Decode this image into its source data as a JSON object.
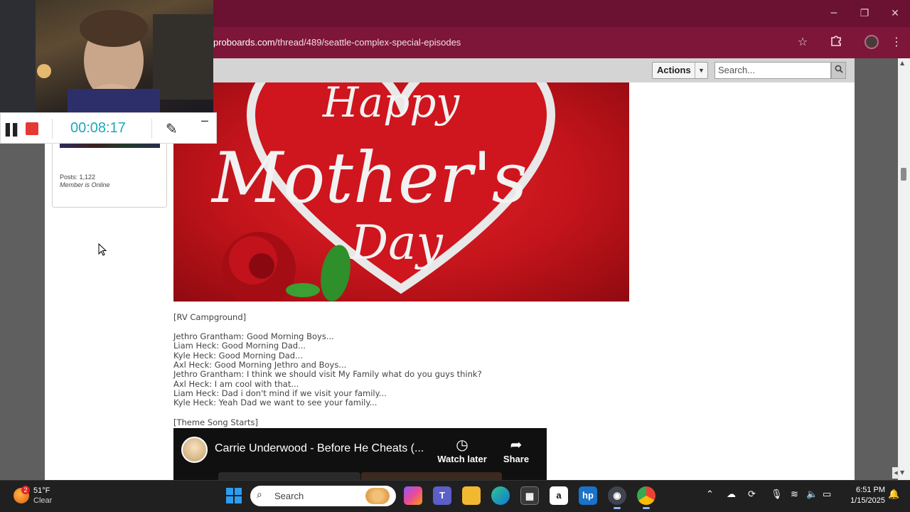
{
  "browser": {
    "url_host": "proboards.com",
    "url_path": "/thread/489/seattle-complex-special-episodes",
    "bookmark_icon": "star-icon",
    "extensions_icon": "puzzle-icon",
    "menu_icon": "kebab-icon",
    "minimize_glyph": "─",
    "maximize_glyph": "❐",
    "close_glyph": "✕"
  },
  "forum": {
    "actions_label": "Actions",
    "search_placeholder": "Search..."
  },
  "user_card": {
    "posts": "Posts: 1,122",
    "status": "Member is Online"
  },
  "hero": {
    "line1": "Happy",
    "line2": "Mother's",
    "line3": "Day"
  },
  "post": {
    "scene1": "[RV Campground]",
    "dialogue": [
      "Jethro Grantham: Good Morning Boys...",
      "Liam Heck: Good Morning Dad...",
      "Kyle Heck: Good Morning Dad...",
      "Axl Heck: Good Morning Jethro and Boys...",
      "Jethro Grantham: I think we should visit My Family what do you guys think?",
      "Axl Heck: I am cool with that...",
      "Liam Heck: Dad i don't mind if we visit your family...",
      "Kyle Heck: Yeah Dad we want to see your family..."
    ],
    "scene2": "[Theme Song Starts]"
  },
  "youtube": {
    "title": "Carrie Underwood - Before He Cheats (...",
    "watch_later": "Watch later",
    "share": "Share"
  },
  "recorder": {
    "timer": "00:08:17",
    "minimize": "─"
  },
  "taskbar": {
    "weather_badge": "2",
    "temperature": "51°F",
    "condition": "Clear",
    "search_label": "Search",
    "time": "6:51 PM",
    "date": "1/15/2025"
  },
  "colors": {
    "titlebar": "#6b1232",
    "addrbar": "#7d1639",
    "timer": "#1da9b5",
    "hero_red": "#d0141c"
  }
}
